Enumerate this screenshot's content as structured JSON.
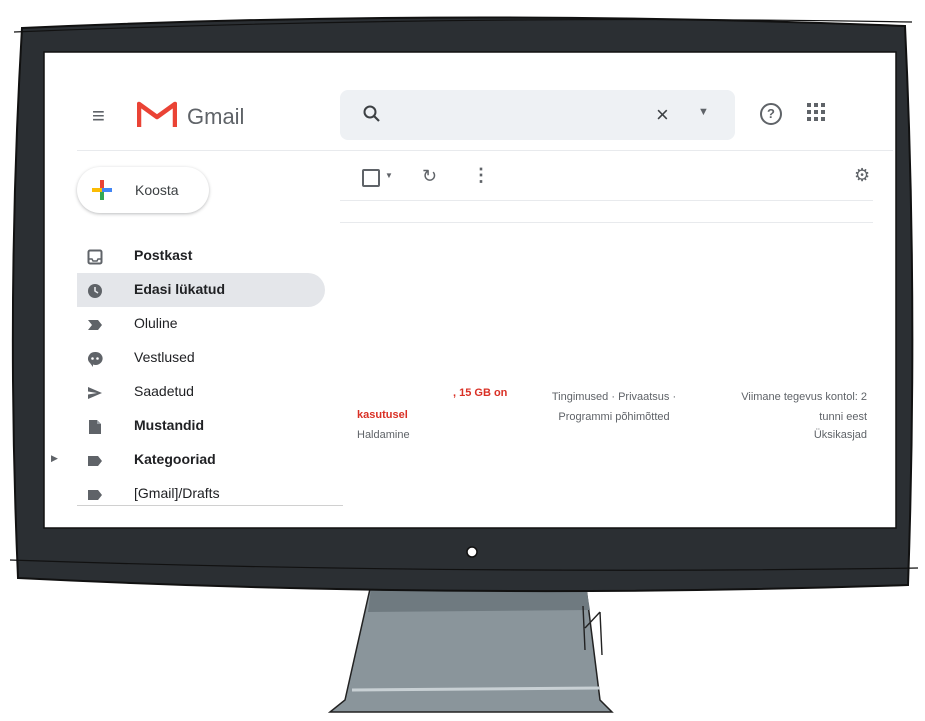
{
  "header": {
    "app_name": "Gmail",
    "search_placeholder": ""
  },
  "compose": {
    "label": "Koosta"
  },
  "sidebar": {
    "items": [
      {
        "label": "Postkast",
        "icon": "inbox-icon",
        "bold": true,
        "active": false
      },
      {
        "label": "Edasi lükatud",
        "icon": "snoozed-icon",
        "bold": true,
        "active": true
      },
      {
        "label": "Oluline",
        "icon": "important-icon",
        "bold": false,
        "active": false
      },
      {
        "label": "Vestlused",
        "icon": "chats-icon",
        "bold": false,
        "active": false
      },
      {
        "label": "Saadetud",
        "icon": "sent-icon",
        "bold": false,
        "active": false
      },
      {
        "label": "Mustandid",
        "icon": "drafts-icon",
        "bold": true,
        "active": false
      },
      {
        "label": "Kategooriad",
        "icon": "label-icon",
        "bold": true,
        "active": false
      },
      {
        "label": "[Gmail]/Drafts",
        "icon": "label-icon",
        "bold": false,
        "active": false
      }
    ]
  },
  "footer": {
    "storage_line1": ", 15 GB on",
    "storage_line2": "kasutusel",
    "manage": "Haldamine",
    "terms_line1": "Tingimused · Privaatsus ·",
    "terms_line2": "Programmi põhimõtted",
    "activity_line1": "Viimane tegevus kontol: 2",
    "activity_line2": "tunni eest",
    "details": "Üksikasjad"
  },
  "colors": {
    "frame": "#2b2f33",
    "stand": "#8a959b",
    "accent_red": "#d93025",
    "active_bg": "#e4e6ea"
  }
}
